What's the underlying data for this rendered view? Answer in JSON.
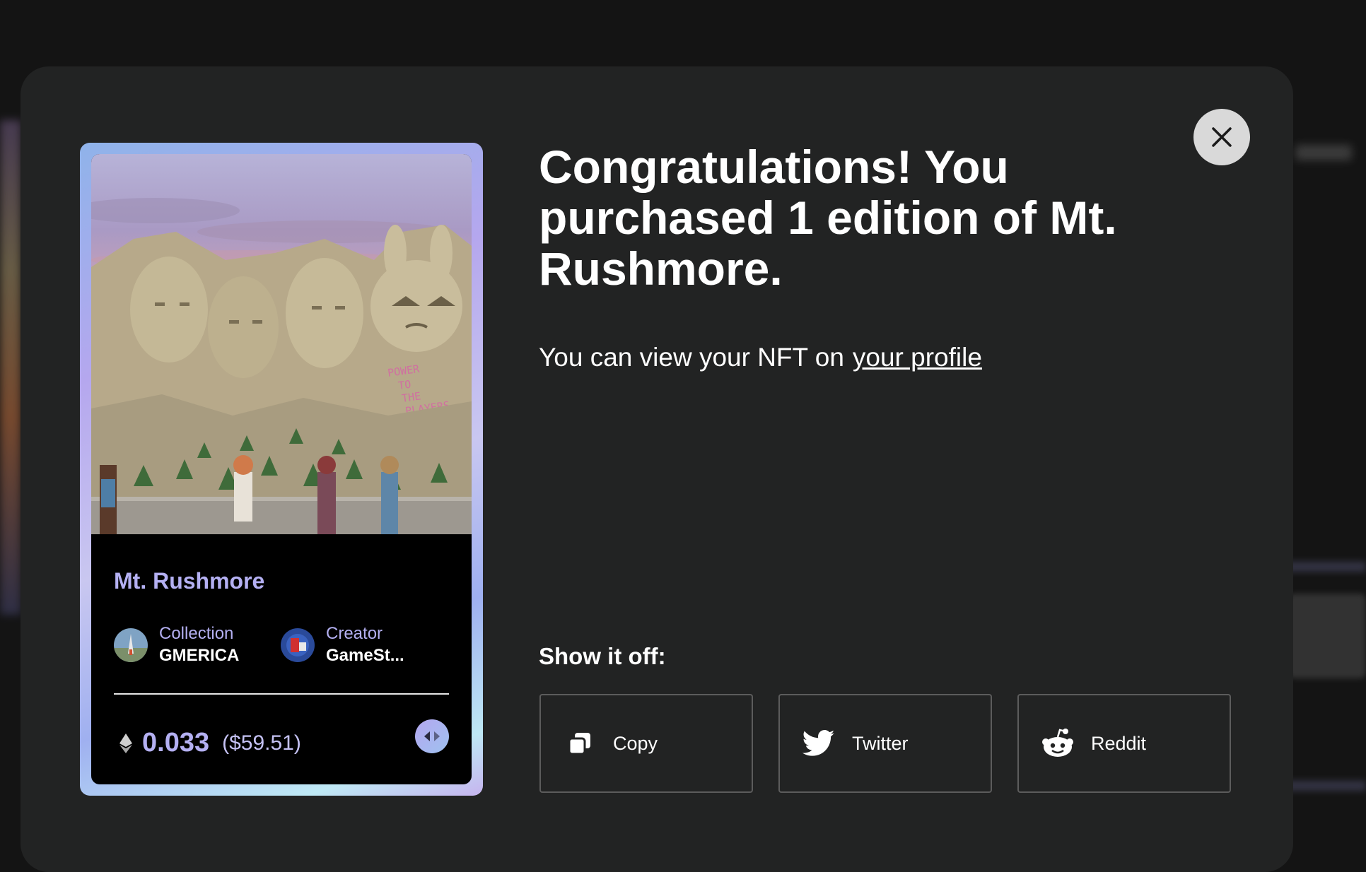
{
  "modal": {
    "heading": "Congratulations! You purchased 1 edition of Mt. Rushmore.",
    "subline_text": "You can view your NFT on",
    "profile_link": "your profile",
    "show_it_off": "Show it off:",
    "close_icon": "close-icon"
  },
  "card": {
    "title": "Mt. Rushmore",
    "artwork_text": [
      "POWER",
      "TO",
      "THE",
      "PLAYERS"
    ],
    "collection_label": "Collection",
    "collection_value": "GMERICA",
    "creator_label": "Creator",
    "creator_value": "GameSt...",
    "price_eth": "0.033",
    "price_usd": "($59.51)",
    "currency_icon": "ethereum-icon",
    "swap_icon": "swap-currency-icon"
  },
  "share": [
    {
      "label": "Copy",
      "icon": "copy-icon"
    },
    {
      "label": "Twitter",
      "icon": "twitter-icon"
    },
    {
      "label": "Reddit",
      "icon": "reddit-icon"
    }
  ],
  "colors": {
    "accent": "#b4b0f2",
    "modal_bg": "#222323",
    "page_bg": "#141414"
  }
}
